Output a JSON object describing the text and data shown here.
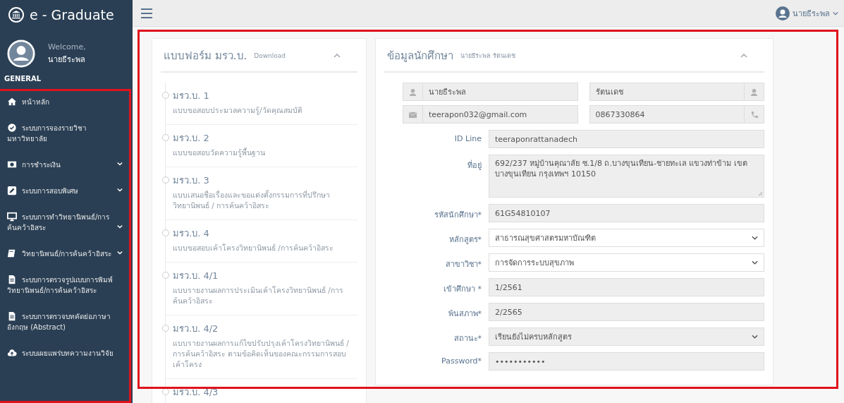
{
  "app": {
    "title": "e - Graduate"
  },
  "profile": {
    "greeting": "Welcome,",
    "name": "นายธีระพล"
  },
  "sidebar": {
    "section": "GENERAL",
    "items": [
      {
        "kind": "home",
        "label": "หน้าหลัก",
        "expandable": false
      },
      {
        "kind": "check",
        "label": "ระบบการจองรายวิชามหาวิทยาลัย",
        "expandable": false
      },
      {
        "kind": "money",
        "label": "การชำระเงิน",
        "expandable": true
      },
      {
        "kind": "edit",
        "label": "ระบบการสอบพิเศษ",
        "expandable": true
      },
      {
        "kind": "desktop",
        "label": "ระบบการทำวิทยานิพนธ์/การค้นคว้าอิสระ",
        "expandable": true
      },
      {
        "kind": "book",
        "label": "วิทยานิพนธ์/การค้นคว้าอิสระ",
        "expandable": true
      },
      {
        "kind": "doc",
        "label": "ระบบการตรวจรูปแบบการพิมพ์วิทยานิพนธ์/การค้นคว้าอิสระ",
        "expandable": false
      },
      {
        "kind": "doc",
        "label": "ระบบการตรวจบทคัดย่อภาษาอังกฤษ (Abstract)",
        "expandable": false
      },
      {
        "kind": "upload",
        "label": "ระบบเผยแพร่บทความงานวิจัย",
        "expandable": false
      }
    ]
  },
  "topbar": {
    "user": "นายธีระพล"
  },
  "forms_panel": {
    "title": "แบบฟอร์ม มรว.บ.",
    "subtitle": "Download",
    "items": [
      {
        "title": "มรว.บ. 1",
        "description": "แบบขอสอบประมวลความรู้/วัดคุณสมบัติ"
      },
      {
        "title": "มรว.บ. 2",
        "description": "แบบขอสอบวัดความรู้พื้นฐาน"
      },
      {
        "title": "มรว.บ. 3",
        "description": "แบบเสนอชื่อเรื่องและขอแต่งตั้งกรรมการที่ปรึกษาวิทยานิพนธ์ / การค้นคว้าอิสระ"
      },
      {
        "title": "มรว.บ. 4",
        "description": "แบบขอสอบเค้าโครงวิทยานิพนธ์ /การค้นคว้าอิสระ"
      },
      {
        "title": "มรว.บ. 4/1",
        "description": "แบบรายงานผลการประเมินเค้าโครงวิทยานิพนธ์ /การค้นคว้าอิสระ"
      },
      {
        "title": "มรว.บ. 4/2",
        "description": "แบบรายงานผลการแก้ไขปรับปรุงเค้าโครงวิทยานิพนธ์ / การค้นคว้าอิสระ ตามข้อคิดเห็นของคณะกรรมการสอบเค้าโครง"
      },
      {
        "title": "มรว.บ. 4/3"
      }
    ]
  },
  "student_panel": {
    "title": "ข้อมูลนักศึกษา",
    "subtitle": "นายธีระพล รัตนเดช",
    "contact": [
      {
        "kind": "user",
        "value": "นายธีระพล"
      },
      {
        "kind": "user",
        "value": "รัตนเดช"
      },
      {
        "kind": "mail",
        "value": "teerapon032@gmail.com"
      },
      {
        "kind": "phone",
        "value": "0867330864"
      }
    ],
    "fields": [
      {
        "kind": "text",
        "label": "ID Line",
        "value": "teeraponrattanadech"
      },
      {
        "kind": "textarea",
        "label": "ที่อยู่",
        "value": "692/237 หมู่บ้านคุณาลัย ซ.1/8 ถ.บางขุนเทียน-ชายทะเล แขวงท่าข้าม เขตบางขุนเทียน กรุงเทพฯ 10150"
      },
      {
        "kind": "text",
        "label": "รหัสนักศึกษา*",
        "value": "61G54810107"
      },
      {
        "kind": "select",
        "label": "หลักสูตร*",
        "value": "สาธารณสุขศาสตรมหาบัณฑิต",
        "disabled": false
      },
      {
        "kind": "select",
        "label": "สาขาวิชา*",
        "value": "การจัดการระบบสุขภาพ",
        "disabled": false
      },
      {
        "kind": "text",
        "label": "เข้าศึกษา *",
        "value": "1/2561"
      },
      {
        "kind": "text",
        "label": "พ้นสภาพ*",
        "value": "2/2565"
      },
      {
        "kind": "select",
        "label": "สถานะ*",
        "value": "เรียนยังไม่ครบหลักสูตร",
        "disabled": true
      },
      {
        "kind": "text",
        "label": "Password*",
        "value": "•••••••••••"
      }
    ]
  }
}
